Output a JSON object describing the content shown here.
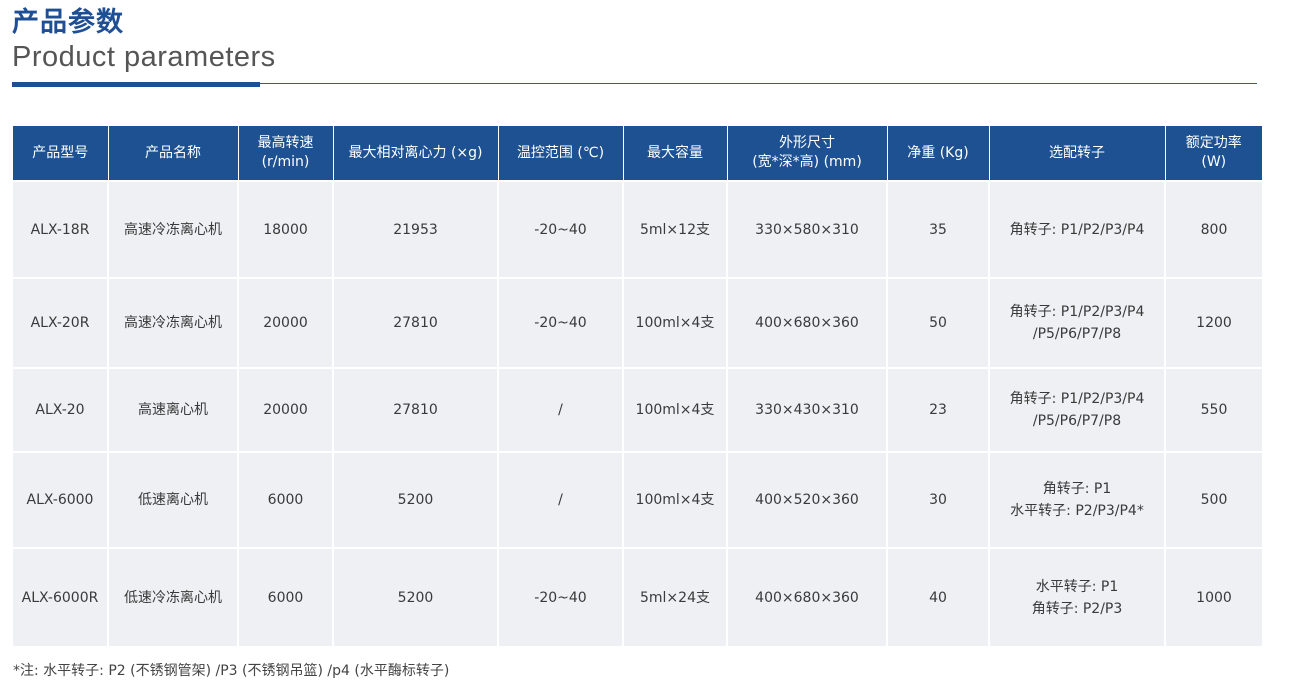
{
  "header": {
    "title_cn": "产品参数",
    "title_en": "Product parameters"
  },
  "colors": {
    "accent": "#1d5191",
    "row_bg": "#eef0f3",
    "title": "#1e4f95"
  },
  "table": {
    "headers": [
      [
        "产品型号"
      ],
      [
        "产品名称"
      ],
      [
        "最高转速",
        "(r/min)"
      ],
      [
        "最大相对离心力 (×g)"
      ],
      [
        "温控范围 (℃)"
      ],
      [
        "最大容量"
      ],
      [
        "外形尺寸",
        "(宽*深*高) (mm)"
      ],
      [
        "净重 (Kg)"
      ],
      [
        "选配转子"
      ],
      [
        "额定功率",
        "(W)"
      ]
    ],
    "rows": [
      {
        "model": "ALX-18R",
        "name": "高速冷冻离心机",
        "speed": "18000",
        "rcf": "21953",
        "temp": "-20~40",
        "capacity": "5ml×12支",
        "size": "330×580×310",
        "weight": "35",
        "rotor": [
          "角转子: P1/P2/P3/P4"
        ],
        "power": "800"
      },
      {
        "model": "ALX-20R",
        "name": "高速冷冻离心机",
        "speed": "20000",
        "rcf": "27810",
        "temp": "-20~40",
        "capacity": "100ml×4支",
        "size": "400×680×360",
        "weight": "50",
        "rotor": [
          "角转子: P1/P2/P3/P4",
          "/P5/P6/P7/P8"
        ],
        "power": "1200"
      },
      {
        "model": "ALX-20",
        "name": "高速离心机",
        "speed": "20000",
        "rcf": "27810",
        "temp": "/",
        "capacity": "100ml×4支",
        "size": "330×430×310",
        "weight": "23",
        "rotor": [
          "角转子: P1/P2/P3/P4",
          "/P5/P6/P7/P8"
        ],
        "power": "550"
      },
      {
        "model": "ALX-6000",
        "name": "低速离心机",
        "speed": "6000",
        "rcf": "5200",
        "temp": "/",
        "capacity": "100ml×4支",
        "size": "400×520×360",
        "weight": "30",
        "rotor": [
          "角转子: P1",
          "水平转子: P2/P3/P4*"
        ],
        "power": "500"
      },
      {
        "model": "ALX-6000R",
        "name": "低速冷冻离心机",
        "speed": "6000",
        "rcf": "5200",
        "temp": "-20~40",
        "capacity": "5ml×24支",
        "size": "400×680×360",
        "weight": "40",
        "rotor": [
          "水平转子: P1",
          "角转子: P2/P3"
        ],
        "power": "1000"
      }
    ]
  },
  "footnote": "*注: 水平转子: P2 (不锈钢管架) /P3 (不锈钢吊篮) /p4 (水平酶标转子)"
}
